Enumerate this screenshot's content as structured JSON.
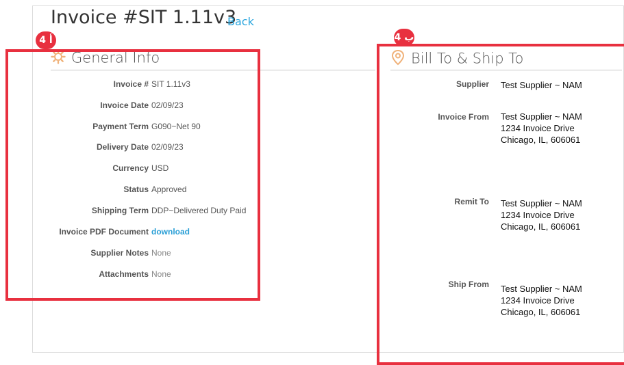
{
  "header": {
    "title": "Invoice #SIT 1.11v3",
    "back_label": "Back"
  },
  "general_info": {
    "heading": "General Info",
    "rows": [
      {
        "label": "Invoice #",
        "value": "SIT 1.11v3"
      },
      {
        "label": "Invoice Date",
        "value": "02/09/23"
      },
      {
        "label": "Payment Term",
        "value": "G090~Net 90"
      },
      {
        "label": "Delivery Date",
        "value": "02/09/23"
      },
      {
        "label": "Currency",
        "value": "USD"
      },
      {
        "label": "Status",
        "value": "Approved"
      },
      {
        "label": "Shipping Term",
        "value": "DDP~Delivered Duty Paid"
      },
      {
        "label": "Invoice PDF Document",
        "value": "download"
      },
      {
        "label": "Supplier Notes",
        "value": "None"
      },
      {
        "label": "Attachments",
        "value": "None"
      }
    ]
  },
  "bill_ship": {
    "heading": "Bill To & Ship To",
    "supplier": {
      "label": "Supplier",
      "value": "Test Supplier ~ NAM"
    },
    "invoice_from": {
      "label": "Invoice From",
      "line1": "Test Supplier ~ NAM",
      "line2": "1234 Invoice Drive",
      "line3": "Chicago, IL, 606061"
    },
    "remit_to": {
      "label": "Remit To",
      "line1": "Test Supplier ~ NAM",
      "line2": "1234 Invoice Drive",
      "line3": "Chicago, IL, 606061"
    },
    "ship_from": {
      "label": "Ship From",
      "line1": "Test Supplier ~ NAM",
      "line2": "1234 Invoice Drive",
      "line3": "Chicago, IL, 606061"
    }
  },
  "annotations": {
    "left_badge": "4 أ",
    "right_badge": "4 ب"
  },
  "colors": {
    "annotation_red": "#e8303f",
    "link_blue": "#2ba6de"
  },
  "icons": {
    "general_info": "gear-icon",
    "bill_ship": "location-pin-icon"
  }
}
